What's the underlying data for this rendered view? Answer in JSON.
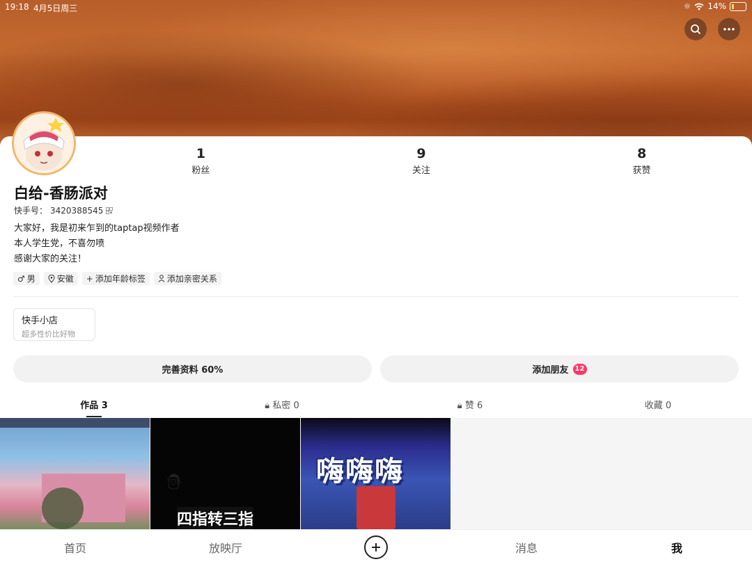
{
  "status": {
    "time": "19:18",
    "date": "4月5日周三",
    "battery": "14%"
  },
  "profile": {
    "name": "白给-香肠派对",
    "id_label": "快手号：",
    "id_value": "3420388545",
    "bio": [
      "大家好，我是初来乍到的taptap视频作者",
      "本人学生党，不喜勿喷",
      "感谢大家的关注！"
    ]
  },
  "stats": [
    {
      "value": "1",
      "label": "粉丝"
    },
    {
      "value": "9",
      "label": "关注"
    },
    {
      "value": "8",
      "label": "获赞"
    }
  ],
  "tags": {
    "gender": "男",
    "location": "安徽",
    "age": "添加年龄标签",
    "relation": "添加亲密关系"
  },
  "shop": {
    "title": "快手小店",
    "subtitle": "超多性价比好物"
  },
  "actions": {
    "complete_profile": "完善资料 60%",
    "add_friend": "添加朋友",
    "add_friend_badge": "12"
  },
  "tabs": [
    {
      "label": "作品 3"
    },
    {
      "label": "私密 0"
    },
    {
      "label": "赞 6"
    },
    {
      "label": "收藏 0"
    }
  ],
  "thumbs": {
    "t2_caption": "四指转三指",
    "t3_caption": "嗨嗨嗨"
  },
  "nav": [
    {
      "label": "首页"
    },
    {
      "label": "放映厅"
    },
    {
      "label": "消息"
    },
    {
      "label": "我"
    }
  ],
  "colors": {
    "badge": "#fe3666",
    "banner": "#c46a30"
  }
}
